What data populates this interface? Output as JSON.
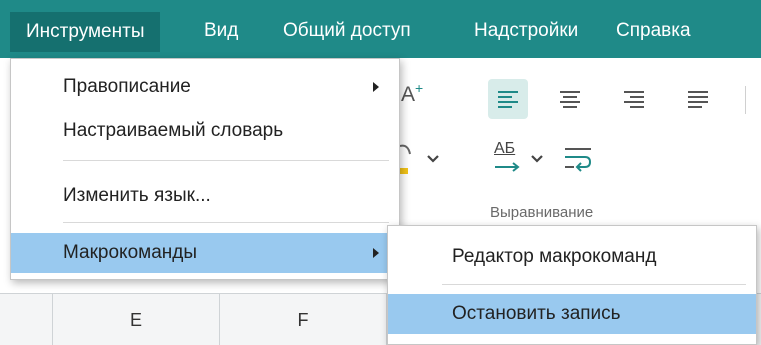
{
  "menubar": {
    "items": [
      "Инструменты",
      "Вид",
      "Общий доступ",
      "Надстройки",
      "Справка"
    ]
  },
  "ribbon": {
    "font_grow_glyph": "A",
    "font_grow_plus": "+",
    "text_direction_label": "АБ",
    "group_label": "Выравнивание"
  },
  "grid": {
    "columns": [
      "E",
      "F"
    ]
  },
  "tools_menu": {
    "items": [
      {
        "label": "Правописание",
        "submenu": true
      },
      {
        "label": "Настраиваемый словарь",
        "submenu": false
      },
      {
        "label": "Изменить язык...",
        "submenu": false
      },
      {
        "label": "Макрокоманды",
        "submenu": true
      }
    ]
  },
  "macros_submenu": {
    "items": [
      {
        "label": "Редактор макрокоманд"
      },
      {
        "label": "Остановить запись"
      }
    ]
  },
  "colors": {
    "menubar_bg": "#1f8a88",
    "menubar_active_bg": "#15706f",
    "menu_highlight": "#99c9ef",
    "accent_teal": "#1f8a88",
    "accent_yellow": "#f2c318"
  }
}
